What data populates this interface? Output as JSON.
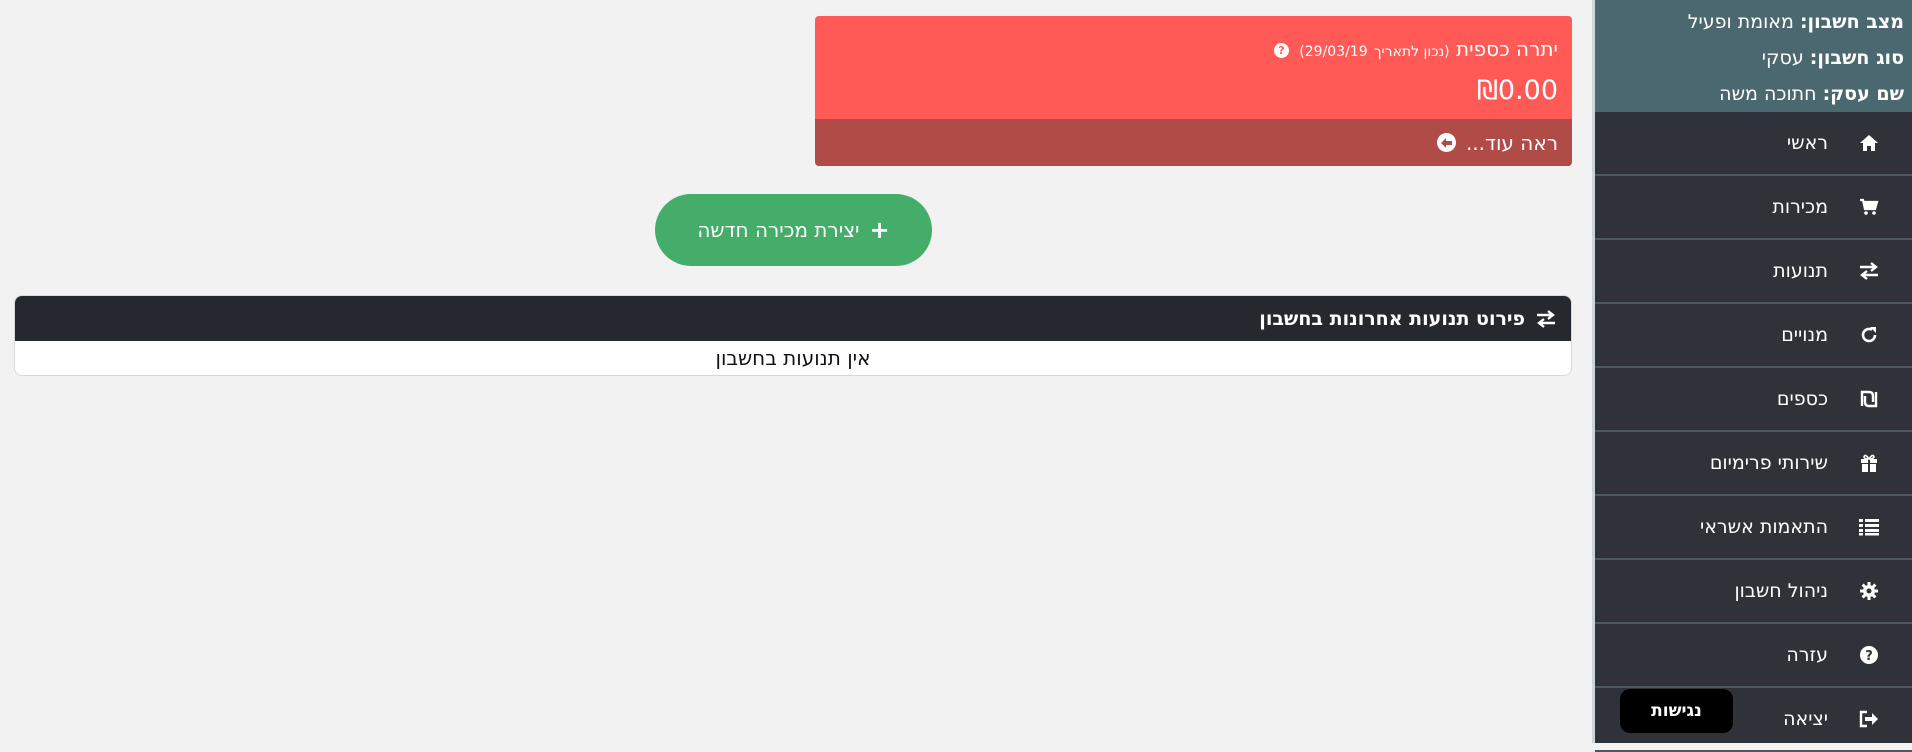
{
  "account": {
    "status_label": "מצב חשבון:",
    "status_value": "מאומת ופעיל",
    "type_label": "סוג חשבון:",
    "type_value": "עסקי",
    "business_label": "שם עסק:",
    "business_value": "חתוכה משה"
  },
  "nav": [
    {
      "label": "ראשי",
      "icon": "home-icon"
    },
    {
      "label": "מכירות",
      "icon": "cart-icon"
    },
    {
      "label": "תנועות",
      "icon": "exchange-icon"
    },
    {
      "label": "מנויים",
      "icon": "refresh-icon"
    },
    {
      "label": "כספים",
      "icon": "shekel-icon"
    },
    {
      "label": "שירותי פרימיום",
      "icon": "gift-icon"
    },
    {
      "label": "התאמות אשראי",
      "icon": "list-icon"
    },
    {
      "label": "ניהול חשבון",
      "icon": "gear-icon"
    },
    {
      "label": "עזרה",
      "icon": "question-circle-icon"
    },
    {
      "label": "יציאה",
      "icon": "sign-out-icon"
    }
  ],
  "accessibility": {
    "label": "נגישות"
  },
  "balance": {
    "title": "יתרה כספית",
    "note": "(נכון לתאריך",
    "date": "29/03/19)",
    "amount": "₪0.00",
    "more_label": "ראה עוד..."
  },
  "new_sale": {
    "label": "יצירת מכירה חדשה"
  },
  "transactions": {
    "title": "פירוט תנועות אחרונות בחשבון",
    "empty": "אין תנועות בחשבון"
  },
  "colors": {
    "sidebar_bg": "#2f3238",
    "account_bg": "#4b6770",
    "balance_bg": "#ff5a55",
    "balance_footer_bg": "#b04b47",
    "accent_green": "#45ad6a",
    "panel_header_bg": "#25282e"
  }
}
